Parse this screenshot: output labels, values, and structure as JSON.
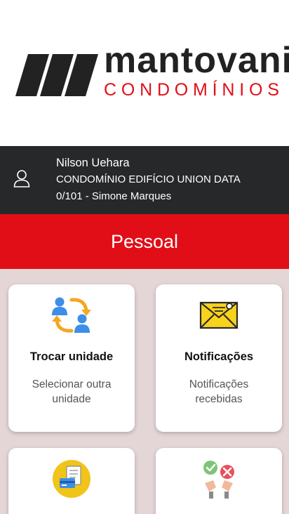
{
  "brand": {
    "name": "mantovani",
    "subtitle": "CONDOMÍNIOS",
    "accent_color": "#e20e17",
    "dark_color": "#222222"
  },
  "user": {
    "name": "Nilson Uehara",
    "condominium": "CONDOMÍNIO EDIFÍCIO UNION DATA",
    "unit": "0/101 - Simone Marques",
    "icon": "user-icon"
  },
  "section": {
    "title": "Pessoal"
  },
  "cards": [
    {
      "title": "Trocar unidade",
      "description": "Selecionar outra unidade",
      "icon": "swap-users-icon"
    },
    {
      "title": "Notificações",
      "description": "Notificações recebidas",
      "icon": "envelope-icon"
    },
    {
      "title": "",
      "description": "",
      "icon": "payment-bill-icon"
    },
    {
      "title": "",
      "description": "",
      "icon": "approval-vote-icon"
    }
  ]
}
